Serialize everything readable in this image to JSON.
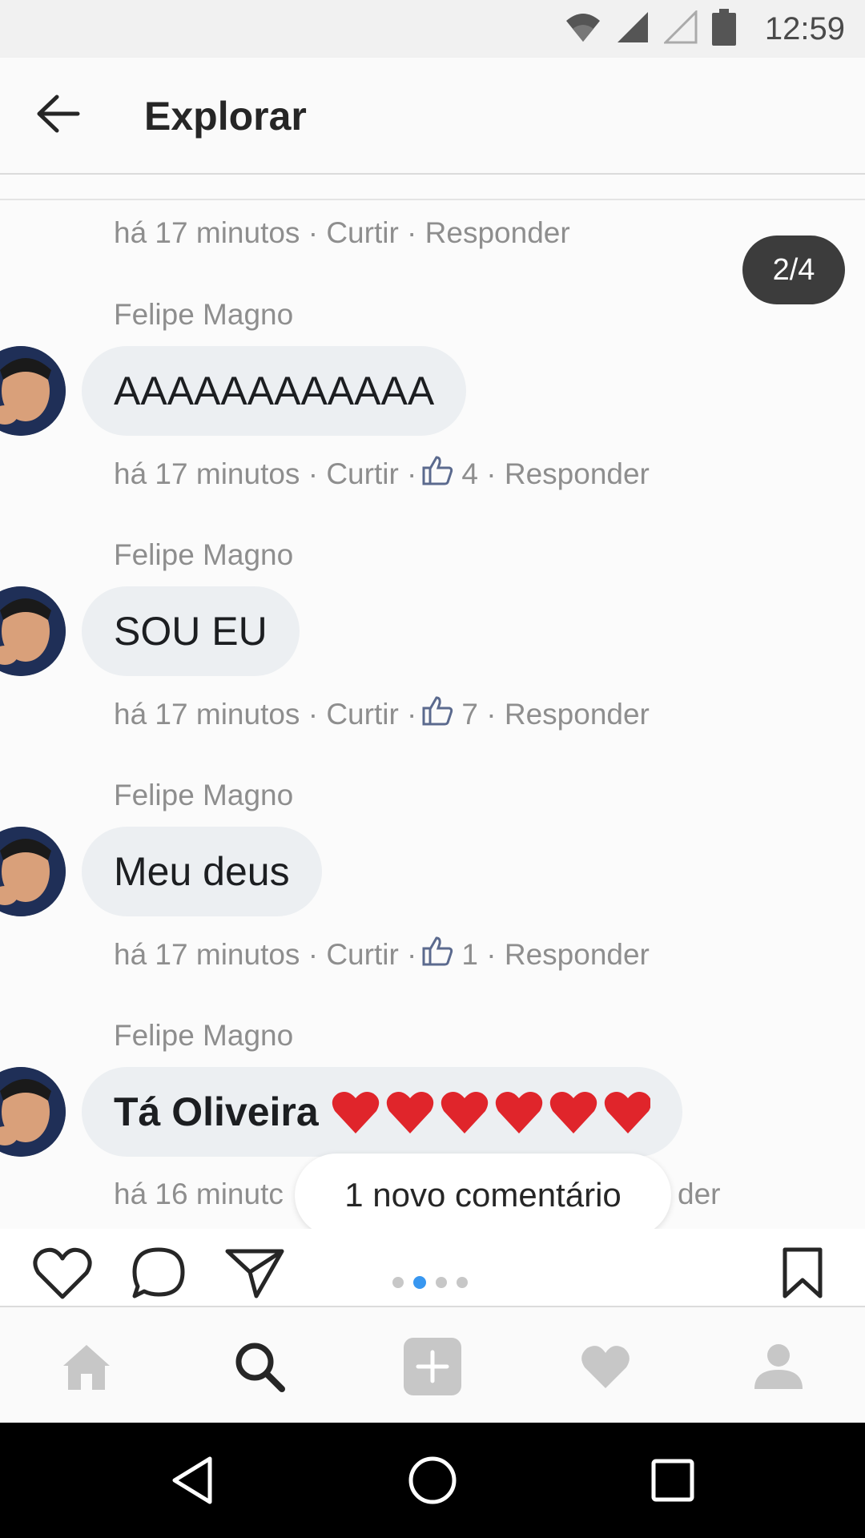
{
  "status_bar": {
    "time": "12:59"
  },
  "header": {
    "title": "Explorar"
  },
  "post": {
    "image_counter": "2/4",
    "top_meta": {
      "time": "há 17 minutos",
      "like": "Curtir",
      "reply": "Responder",
      "sep": "·"
    },
    "comments": [
      {
        "name": "Felipe Magno",
        "text": "AAAAAAAAAAAA",
        "time": "há 17 minutos",
        "like": "Curtir",
        "likes": "4",
        "reply": "Responder"
      },
      {
        "name": "Felipe Magno",
        "text": "SOU EU",
        "time": "há 17 minutos",
        "like": "Curtir",
        "likes": "7",
        "reply": "Responder"
      },
      {
        "name": "Felipe Magno",
        "text": "Meu deus",
        "time": "há 17 minutos",
        "like": "Curtir",
        "likes": "1",
        "reply": "Responder"
      },
      {
        "name": "Felipe Magno",
        "text": "Tá Oliveira",
        "hearts": "❤❤❤❤❤❤",
        "time": "há 16 minutc",
        "tail": "der"
      }
    ],
    "new_comment_label": "1 novo comentário"
  },
  "carousel": {
    "count": 4,
    "active_index": 1
  },
  "icons": {
    "back": "arrow-left-icon",
    "like": "heart-outline-icon",
    "comment": "comment-bubble-icon",
    "share": "paper-plane-icon",
    "save": "bookmark-icon",
    "nav": [
      "home-icon",
      "search-icon",
      "add-post-icon",
      "activity-heart-icon",
      "profile-icon"
    ]
  },
  "colors": {
    "accent_dot": "#3897f0",
    "badge_bg": "#3c3c3c",
    "bubble_bg": "#eceff2",
    "heart": "#e0252b"
  }
}
